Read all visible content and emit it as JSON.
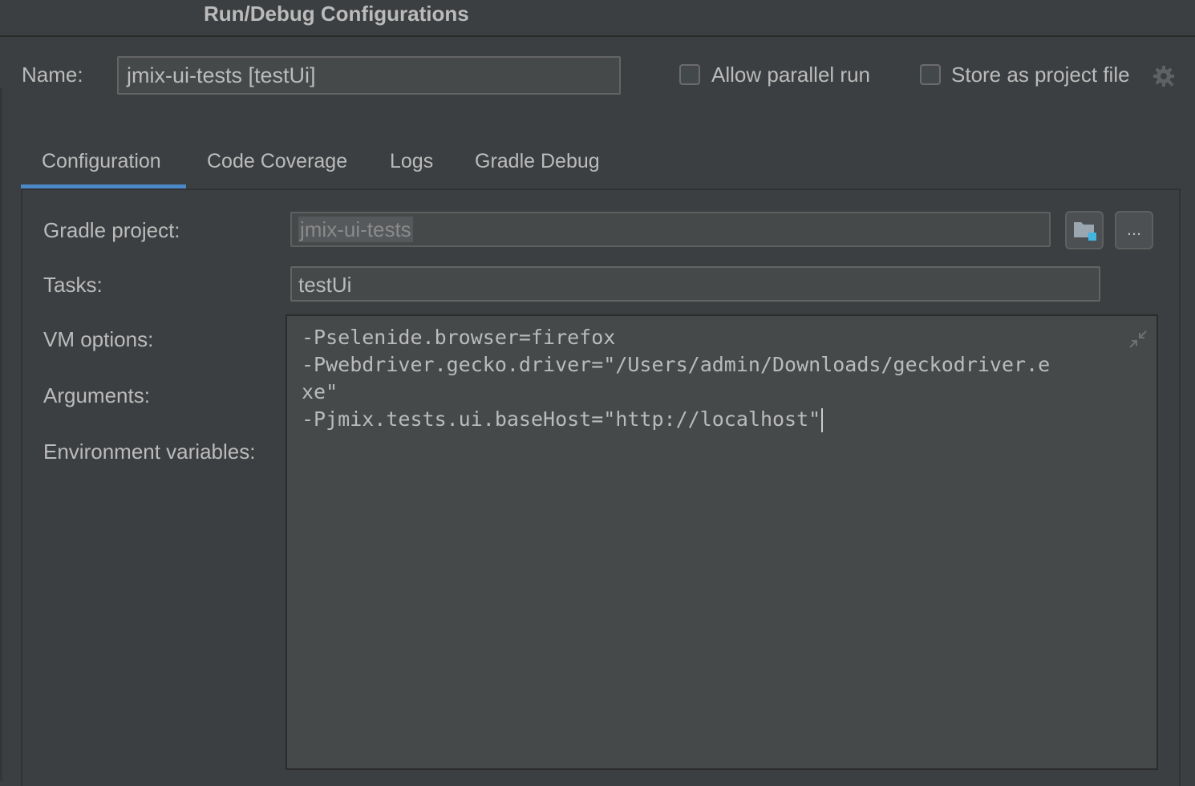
{
  "window": {
    "title": "Run/Debug Configurations"
  },
  "header": {
    "name_label": "Name:",
    "name_value": "jmix-ui-tests [testUi]",
    "allow_parallel_label": "Allow parallel run",
    "allow_parallel_checked": false,
    "store_project_label": "Store as project file",
    "store_project_checked": false,
    "settings_icon": "gear-icon"
  },
  "tabs": [
    {
      "label": "Configuration",
      "selected": true
    },
    {
      "label": "Code Coverage",
      "selected": false
    },
    {
      "label": "Logs",
      "selected": false
    },
    {
      "label": "Gradle Debug",
      "selected": false
    }
  ],
  "form": {
    "gradle_project_label": "Gradle project:",
    "gradle_project_value": "jmix-ui-tests",
    "browse_icon": "folder-icon",
    "more_button_label": "...",
    "tasks_label": "Tasks:",
    "tasks_value": "testUi",
    "vm_options_label": "VM options:",
    "arguments_label": "Arguments:",
    "env_vars_label": "Environment variables:",
    "vm_options_lines": [
      "-Pselenide.browser=firefox",
      "-Pwebdriver.gecko.driver=\"/Users/admin/Downloads/geckodriver.e",
      "xe\"",
      "-Pjmix.tests.ui.baseHost=\"http://localhost\""
    ],
    "collapse_icon": "collapse-icon"
  },
  "colors": {
    "background": "#3c3f41",
    "field_bg": "#45494a",
    "accent": "#4a88c7",
    "text": "#bbbbbb"
  }
}
